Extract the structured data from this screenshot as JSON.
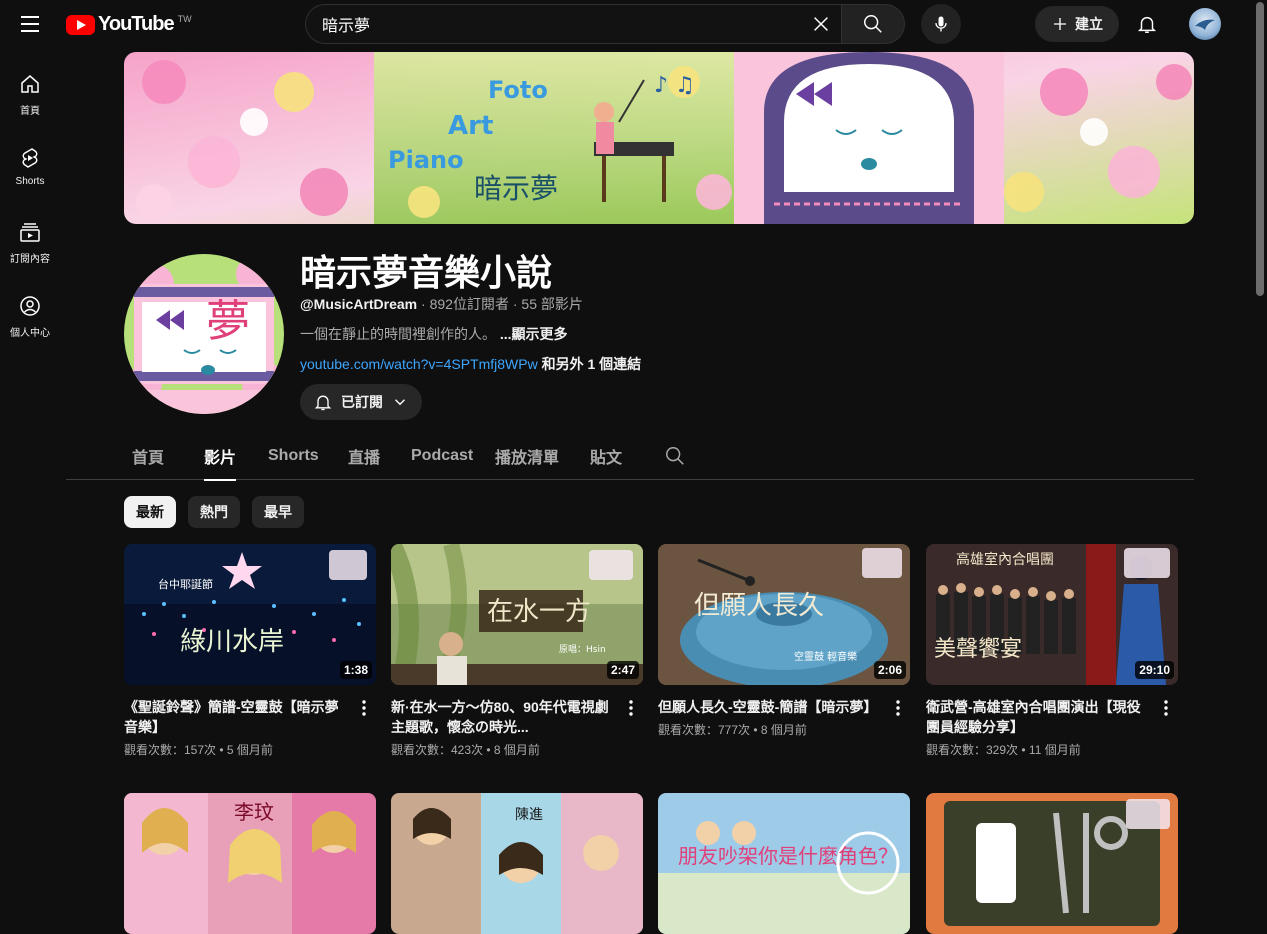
{
  "header": {
    "logo_text": "YouTube",
    "region": "TW",
    "search_value": "暗示夢",
    "create_label": "建立"
  },
  "sidebar": {
    "items": [
      {
        "label": "首頁",
        "icon": "home-icon"
      },
      {
        "label": "Shorts",
        "icon": "shorts-icon"
      },
      {
        "label": "訂閱內容",
        "icon": "subscriptions-icon"
      },
      {
        "label": "個人中心",
        "icon": "you-icon"
      }
    ]
  },
  "banner": {
    "text_foto": "Foto",
    "text_art": "Art",
    "text_piano": "Piano",
    "calligraphy": "暗示夢"
  },
  "channel": {
    "name": "暗示夢音樂小說",
    "handle": "@MusicArtDream",
    "subscribers": "892位訂閱者",
    "videos": "55 部影片",
    "description": "一個在靜止的時間裡創作的人。",
    "show_more": "...顯示更多",
    "link": "youtube.com/watch?v=4SPTmfj8WPw",
    "link_extra": "和另外 1 個連結",
    "subscribed_label": "已訂閱",
    "avatar_glyph": "夢"
  },
  "tabs": [
    "首頁",
    "影片",
    "Shorts",
    "直播",
    "Podcast",
    "播放清單",
    "貼文"
  ],
  "active_tab": "影片",
  "chips": [
    "最新",
    "熱門",
    "最早"
  ],
  "videos": [
    {
      "title": "《聖誕鈴聲》簡譜-空靈鼓【暗示夢音樂】",
      "views": "觀看次數：157次",
      "age": "5 個月前",
      "duration": "1:38",
      "thumb_text": "綠川水岸",
      "thumb_sub": "台中耶誕節"
    },
    {
      "title": "新·在水一方～仿80、90年代電視劇主題歌，懷念の時光...",
      "views": "觀看次數：423次",
      "age": "8 個月前",
      "duration": "2:47",
      "thumb_text": "在水一方",
      "thumb_sub": "原唱：Hsin"
    },
    {
      "title": "但願人長久-空靈鼓-簡譜【暗示夢】",
      "views": "觀看次數：777次",
      "age": "8 個月前",
      "duration": "2:06",
      "thumb_text": "但願人長久",
      "thumb_sub": "空靈鼓 輕音樂"
    },
    {
      "title": "衛武營-高雄室內合唱團演出【現役團員經驗分享】",
      "views": "觀看次數：329次",
      "age": "11 個月前",
      "duration": "29:10",
      "thumb_text": "美聲饗宴",
      "thumb_sub": "高雄室內合唱團"
    }
  ],
  "videos_row2": [
    {
      "thumb_text": "李玟"
    },
    {
      "thumb_text": "陳進"
    },
    {
      "thumb_text": "朋友吵架你是什麼角色？"
    },
    {
      "thumb_text": ""
    }
  ],
  "colors": {
    "background": "#0f0f0f",
    "link": "#3ea6ff",
    "brand_red": "#ff0000"
  }
}
